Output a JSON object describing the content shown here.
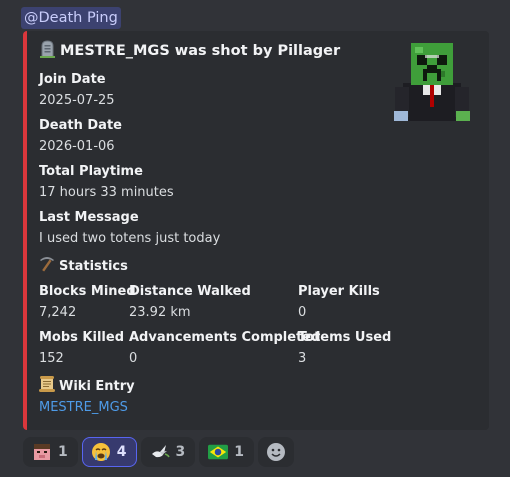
{
  "mention": "@Death Ping",
  "embed": {
    "accent_color": "#da373c",
    "title": "MESTRE_MGS was shot by Pillager",
    "title_icon": "headstone-icon",
    "thumbnail": "creeper-skin-avatar",
    "fields": {
      "join_date": {
        "name": "Join Date",
        "value": "2025-07-25"
      },
      "death_date": {
        "name": "Death Date",
        "value": "2026-01-06"
      },
      "playtime": {
        "name": "Total Playtime",
        "value": "17 hours 33 minutes"
      },
      "last_message": {
        "name": "Last Message",
        "value": "I used two totens just today"
      }
    },
    "statistics": {
      "title": "Statistics",
      "icon": "pickaxe-icon",
      "blocks_mined": {
        "name": "Blocks Mined",
        "value": "7,242"
      },
      "distance_walked": {
        "name": "Distance Walked",
        "value": "23.92 km"
      },
      "player_kills": {
        "name": "Player Kills",
        "value": "0"
      },
      "mobs_killed": {
        "name": "Mobs Killed",
        "value": "152"
      },
      "advancements": {
        "name": "Advancements Completed",
        "value": "0"
      },
      "totems_used": {
        "name": "Totems Used",
        "value": "3"
      }
    },
    "wiki": {
      "title": "Wiki Entry",
      "icon": "scroll-icon",
      "link": "MESTRE_MGS"
    }
  },
  "reactions": [
    {
      "emoji": "pig-face-skin-icon",
      "count": "1",
      "active": false
    },
    {
      "emoji": "crying-face-icon",
      "count": "4",
      "active": true
    },
    {
      "emoji": "dove-icon",
      "count": "3",
      "active": false
    },
    {
      "emoji": "brazil-flag-icon",
      "count": "1",
      "active": false
    }
  ],
  "add_reaction_icon": "add-reaction-smiley-icon"
}
